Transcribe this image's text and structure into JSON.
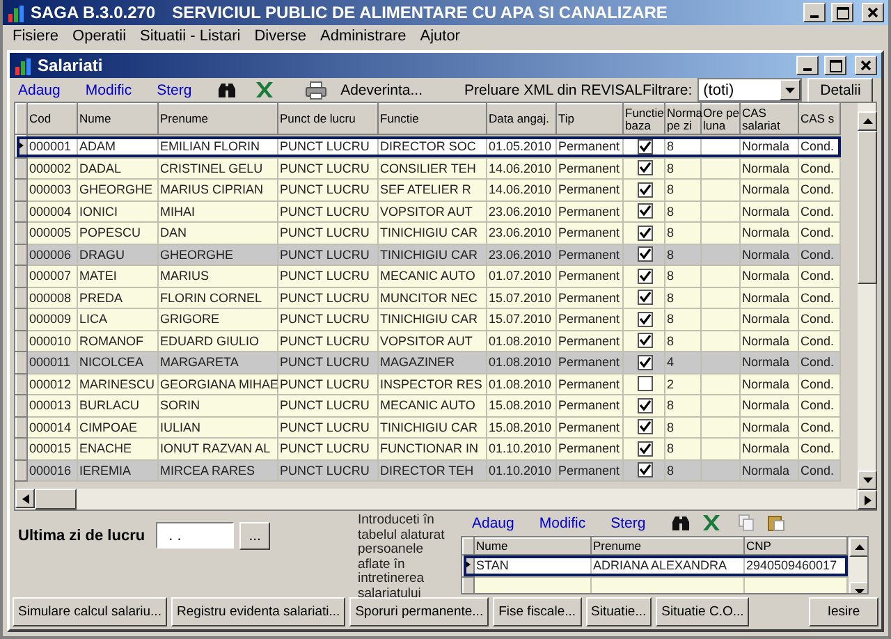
{
  "app": {
    "title": "SAGA B.3.0.270",
    "company": "SERVICIUL PUBLIC DE ALIMENTARE CU APA SI CANALIZARE"
  },
  "menu": [
    "Fisiere",
    "Operatii",
    "Situatii - Listari",
    "Diverse",
    "Administrare",
    "Ajutor"
  ],
  "window": {
    "title": "Salariati"
  },
  "toolbar": {
    "links": [
      "Adaug",
      "Modific",
      "Sterg"
    ],
    "certificate": "Adeverinta...",
    "revisal": "Preluare XML din REVISAL",
    "filter_label": "Filtrare:",
    "filter_value": "(toti)",
    "details": "Detalii"
  },
  "table": {
    "columns": [
      "Cod",
      "Nume",
      "Prenume",
      "Punct de lucru",
      "Functie",
      "Data angaj.",
      "Tip",
      "Functie baza",
      "Norma pe zi",
      "Ore pe luna",
      "CAS salariat",
      "CAS s"
    ],
    "rows": [
      {
        "cod": "000001",
        "nume": "ADAM",
        "prenume": "EMILIAN FLORIN",
        "punct": "PUNCT LUCRU",
        "functie": "DIRECTOR SOC",
        "data": "01.05.2010",
        "tip": "Permanent",
        "functie_baza": true,
        "norma": "8",
        "cas_salariat": "Normala",
        "cas_s": "Cond.",
        "highlighted": false,
        "current": true
      },
      {
        "cod": "000002",
        "nume": "DADAL",
        "prenume": "CRISTINEL GELU",
        "punct": "PUNCT LUCRU",
        "functie": "CONSILIER TEH",
        "data": "14.06.2010",
        "tip": "Permanent",
        "functie_baza": true,
        "norma": "8",
        "cas_salariat": "Normala",
        "cas_s": "Cond.",
        "highlighted": false,
        "current": false
      },
      {
        "cod": "000003",
        "nume": "GHEORGHE",
        "prenume": "MARIUS CIPRIAN",
        "punct": "PUNCT LUCRU",
        "functie": "SEF ATELIER R",
        "data": "14.06.2010",
        "tip": "Permanent",
        "functie_baza": true,
        "norma": "8",
        "cas_salariat": "Normala",
        "cas_s": "Cond.",
        "highlighted": false,
        "current": false
      },
      {
        "cod": "000004",
        "nume": "IONICI",
        "prenume": "MIHAI",
        "punct": "PUNCT LUCRU",
        "functie": "VOPSITOR AUT",
        "data": "23.06.2010",
        "tip": "Permanent",
        "functie_baza": true,
        "norma": "8",
        "cas_salariat": "Normala",
        "cas_s": "Cond.",
        "highlighted": false,
        "current": false
      },
      {
        "cod": "000005",
        "nume": "POPESCU",
        "prenume": "DAN",
        "punct": "PUNCT LUCRU",
        "functie": "TINICHIGIU CAR",
        "data": "23.06.2010",
        "tip": "Permanent",
        "functie_baza": true,
        "norma": "8",
        "cas_salariat": "Normala",
        "cas_s": "Cond.",
        "highlighted": false,
        "current": false
      },
      {
        "cod": "000006",
        "nume": "DRAGU",
        "prenume": "GHEORGHE",
        "punct": "PUNCT LUCRU",
        "functie": "TINICHIGIU CAR",
        "data": "23.06.2010",
        "tip": "Permanent",
        "functie_baza": true,
        "norma": "8",
        "cas_salariat": "Normala",
        "cas_s": "Cond.",
        "highlighted": true,
        "current": false
      },
      {
        "cod": "000007",
        "nume": "MATEI",
        "prenume": "MARIUS",
        "punct": "PUNCT LUCRU",
        "functie": "MECANIC AUTO",
        "data": "01.07.2010",
        "tip": "Permanent",
        "functie_baza": true,
        "norma": "8",
        "cas_salariat": "Normala",
        "cas_s": "Cond.",
        "highlighted": false,
        "current": false
      },
      {
        "cod": "000008",
        "nume": "PREDA",
        "prenume": "FLORIN CORNEL",
        "punct": "PUNCT LUCRU",
        "functie": "MUNCITOR NEC",
        "data": "15.07.2010",
        "tip": "Permanent",
        "functie_baza": true,
        "norma": "8",
        "cas_salariat": "Normala",
        "cas_s": "Cond.",
        "highlighted": false,
        "current": false
      },
      {
        "cod": "000009",
        "nume": "LICA",
        "prenume": "GRIGORE",
        "punct": "PUNCT LUCRU",
        "functie": "TINICHIGIU CAR",
        "data": "15.07.2010",
        "tip": "Permanent",
        "functie_baza": true,
        "norma": "8",
        "cas_salariat": "Normala",
        "cas_s": "Cond.",
        "highlighted": false,
        "current": false
      },
      {
        "cod": "000010",
        "nume": "ROMANOF",
        "prenume": "EDUARD GIULIO",
        "punct": "PUNCT LUCRU",
        "functie": "VOPSITOR AUT",
        "data": "01.08.2010",
        "tip": "Permanent",
        "functie_baza": true,
        "norma": "8",
        "cas_salariat": "Normala",
        "cas_s": "Cond.",
        "highlighted": false,
        "current": false
      },
      {
        "cod": "000011",
        "nume": "NICOLCEA",
        "prenume": "MARGARETA",
        "punct": "PUNCT LUCRU",
        "functie": "MAGAZINER",
        "data": "01.08.2010",
        "tip": "Permanent",
        "functie_baza": true,
        "norma": "4",
        "cas_salariat": "Normala",
        "cas_s": "Cond.",
        "highlighted": true,
        "current": false
      },
      {
        "cod": "000012",
        "nume": "MARINESCU",
        "prenume": "GEORGIANA MIHAE",
        "punct": "PUNCT LUCRU",
        "functie": "INSPECTOR RES",
        "data": "01.08.2010",
        "tip": "Permanent",
        "functie_baza": false,
        "norma": "2",
        "cas_salariat": "Normala",
        "cas_s": "Cond.",
        "highlighted": false,
        "current": false
      },
      {
        "cod": "000013",
        "nume": "BURLACU",
        "prenume": "SORIN",
        "punct": "PUNCT LUCRU",
        "functie": "MECANIC AUTO",
        "data": "15.08.2010",
        "tip": "Permanent",
        "functie_baza": true,
        "norma": "8",
        "cas_salariat": "Normala",
        "cas_s": "Cond.",
        "highlighted": false,
        "current": false
      },
      {
        "cod": "000014",
        "nume": "CIMPOAE",
        "prenume": "IULIAN",
        "punct": "PUNCT LUCRU",
        "functie": "TINICHIGIU CAR",
        "data": "15.08.2010",
        "tip": "Permanent",
        "functie_baza": true,
        "norma": "8",
        "cas_salariat": "Normala",
        "cas_s": "Cond.",
        "highlighted": false,
        "current": false
      },
      {
        "cod": "000015",
        "nume": "ENACHE",
        "prenume": "IONUT RAZVAN AL",
        "punct": "PUNCT LUCRU",
        "functie": "FUNCTIONAR IN",
        "data": "01.10.2010",
        "tip": "Permanent",
        "functie_baza": true,
        "norma": "8",
        "cas_salariat": "Normala",
        "cas_s": "Cond.",
        "highlighted": false,
        "current": false
      },
      {
        "cod": "000016",
        "nume": "IEREMIA",
        "prenume": "MIRCEA RARES",
        "punct": "PUNCT LUCRU",
        "functie": "DIRECTOR TEH",
        "data": "01.10.2010",
        "tip": "Permanent",
        "functie_baza": true,
        "norma": "8",
        "cas_salariat": "Normala",
        "cas_s": "Cond.",
        "highlighted": true,
        "current": false
      }
    ]
  },
  "last_day": {
    "label": "Ultima zi de lucru",
    "value": ". .",
    "button": "..."
  },
  "dependents": {
    "note": "Introduceti în tabelul alaturat persoanele aflate în intretinerea salariatului",
    "links": [
      "Adaug",
      "Modific",
      "Sterg"
    ],
    "columns": [
      "Nume",
      "Prenume",
      "CNP"
    ],
    "rows": [
      {
        "nume": "STAN",
        "prenume": "ADRIANA ALEXANDRA",
        "cnp": "2940509460017",
        "current": true
      }
    ]
  },
  "buttons": [
    "Simulare calcul salariu...",
    "Registru evidenta salariati...",
    "Sporuri permanente...",
    "Fise fiscale...",
    "Situatie...",
    "Situatie C.O...",
    "Iesire"
  ]
}
